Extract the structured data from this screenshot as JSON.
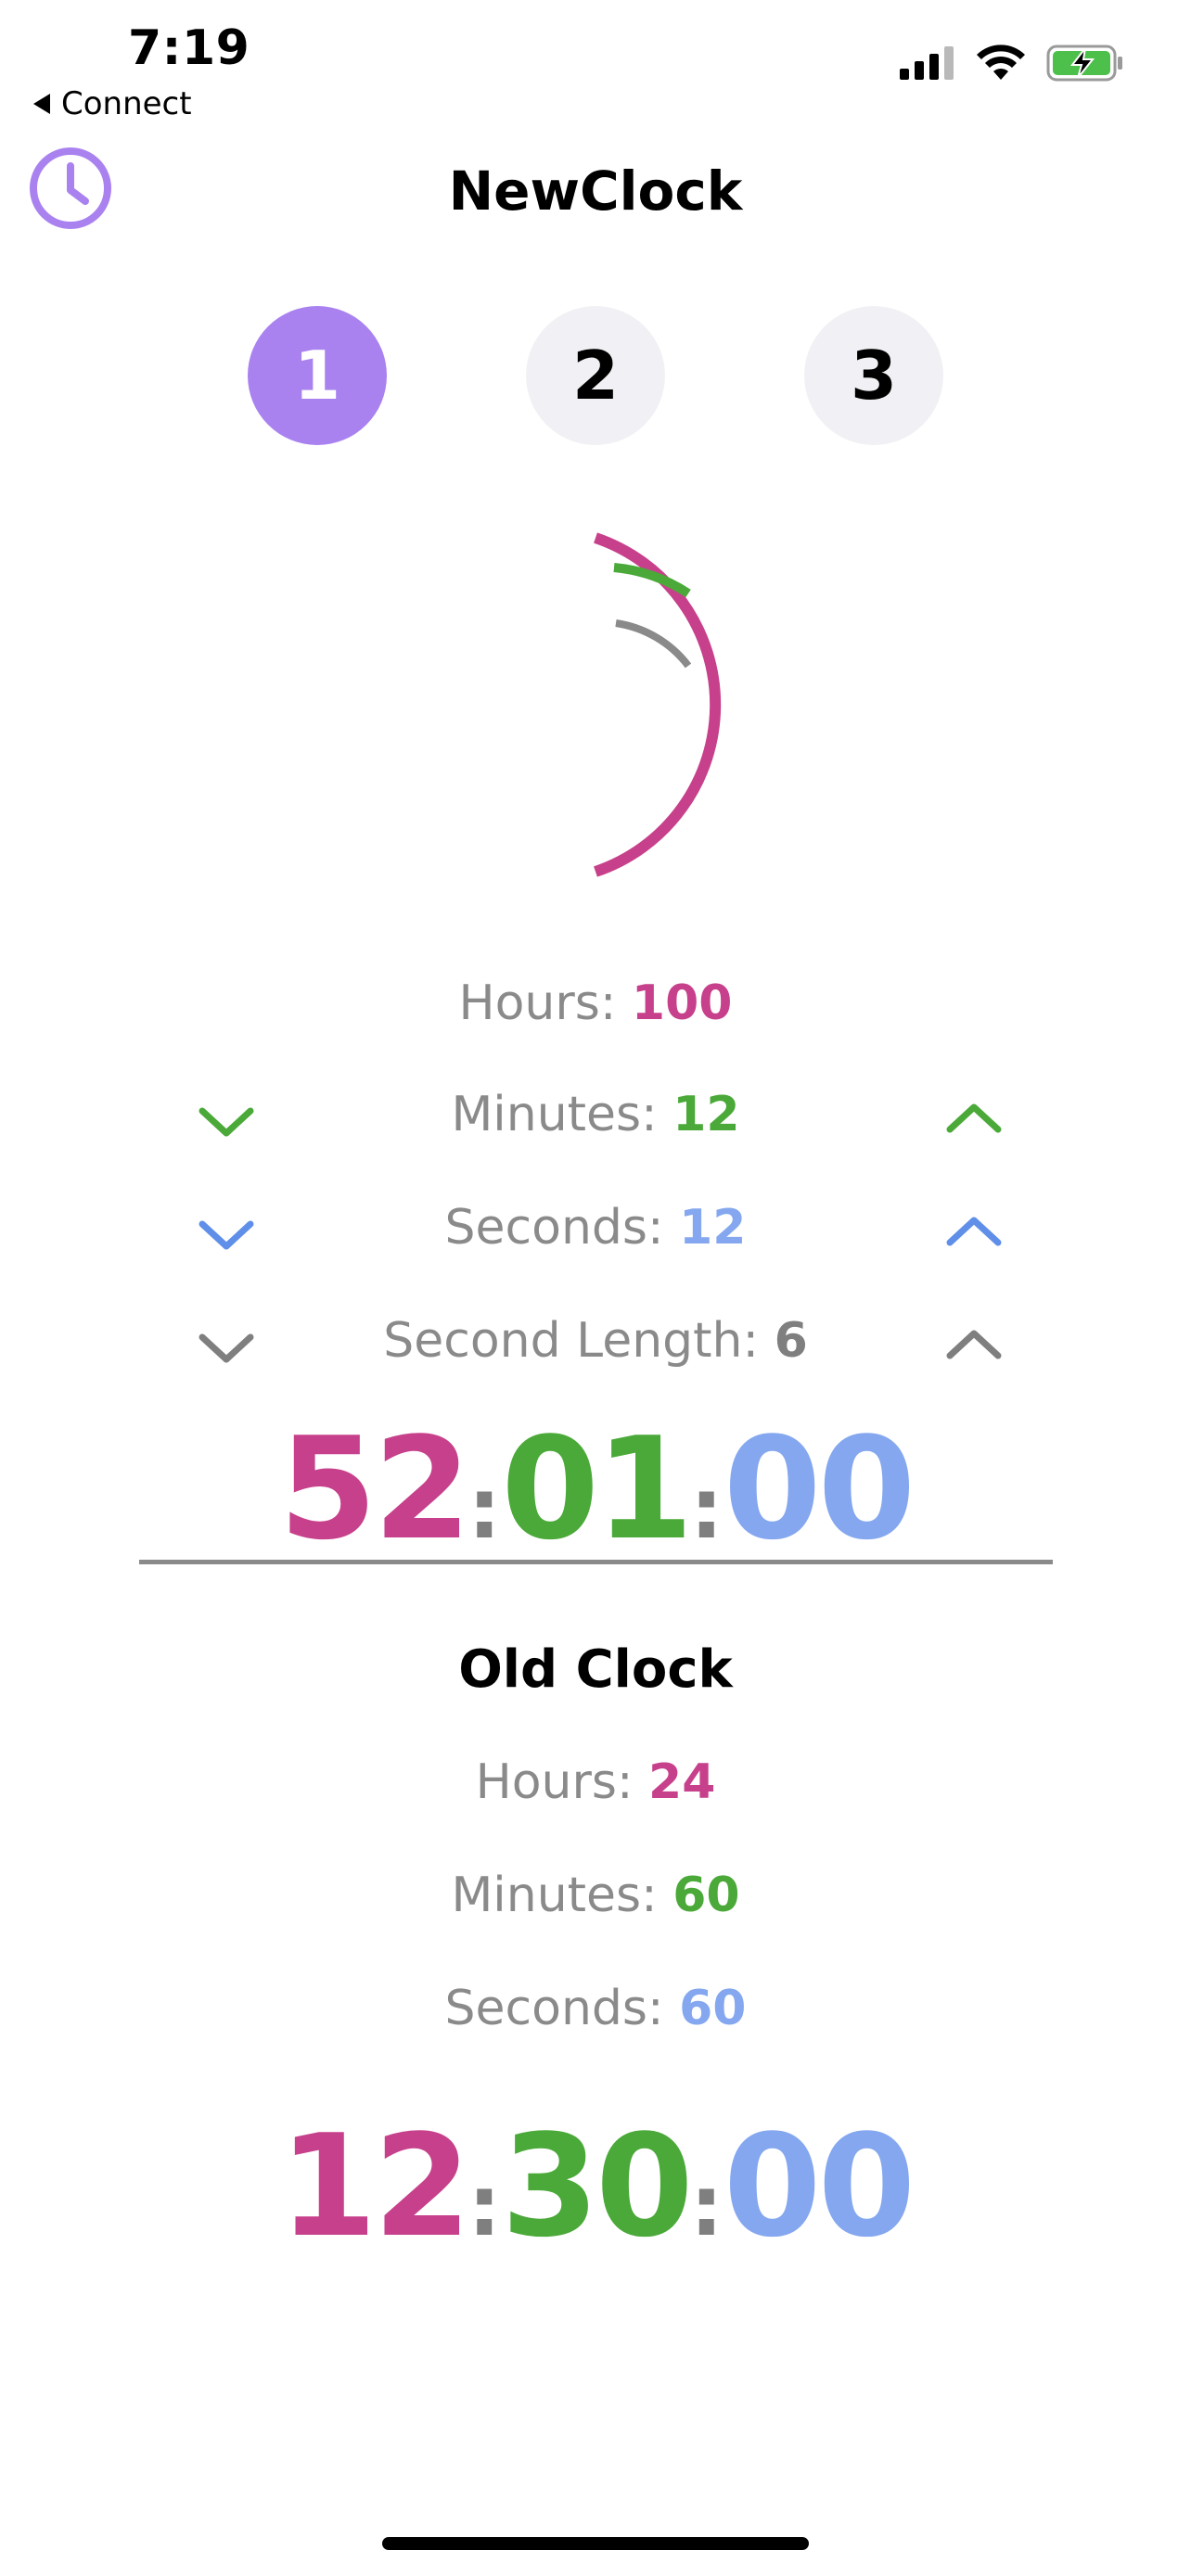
{
  "status_bar": {
    "time": "7:19",
    "back_label": "Connect",
    "icons": [
      "signal-icon",
      "wifi-icon",
      "battery-charging-icon"
    ]
  },
  "header": {
    "title": "NewClock",
    "left_icon": "clock-icon"
  },
  "steps": {
    "items": [
      "1",
      "2",
      "3"
    ],
    "active": "1",
    "active_color": "#a982f0"
  },
  "new_clock": {
    "hours_label": "Hours:",
    "hours_value": "100",
    "minutes_label": "Minutes:",
    "minutes_value": "12",
    "seconds_label": "Seconds:",
    "seconds_value": "12",
    "second_length_label": "Second Length:",
    "second_length_value": "6",
    "display": {
      "hours": "52",
      "minutes": "01",
      "seconds": "00",
      "separator": ":"
    }
  },
  "old_clock": {
    "title": "Old Clock",
    "hours_label": "Hours:",
    "hours_value": "24",
    "minutes_label": "Minutes:",
    "minutes_value": "60",
    "seconds_label": "Seconds:",
    "seconds_value": "60",
    "display": {
      "hours": "12",
      "minutes": "30",
      "seconds": "00",
      "separator": ":"
    }
  },
  "colors": {
    "hours": "#c7408b",
    "minutes": "#4aa938",
    "seconds": "#84a7ef",
    "second_length": "#7f7f7f",
    "accent": "#a982f0"
  }
}
